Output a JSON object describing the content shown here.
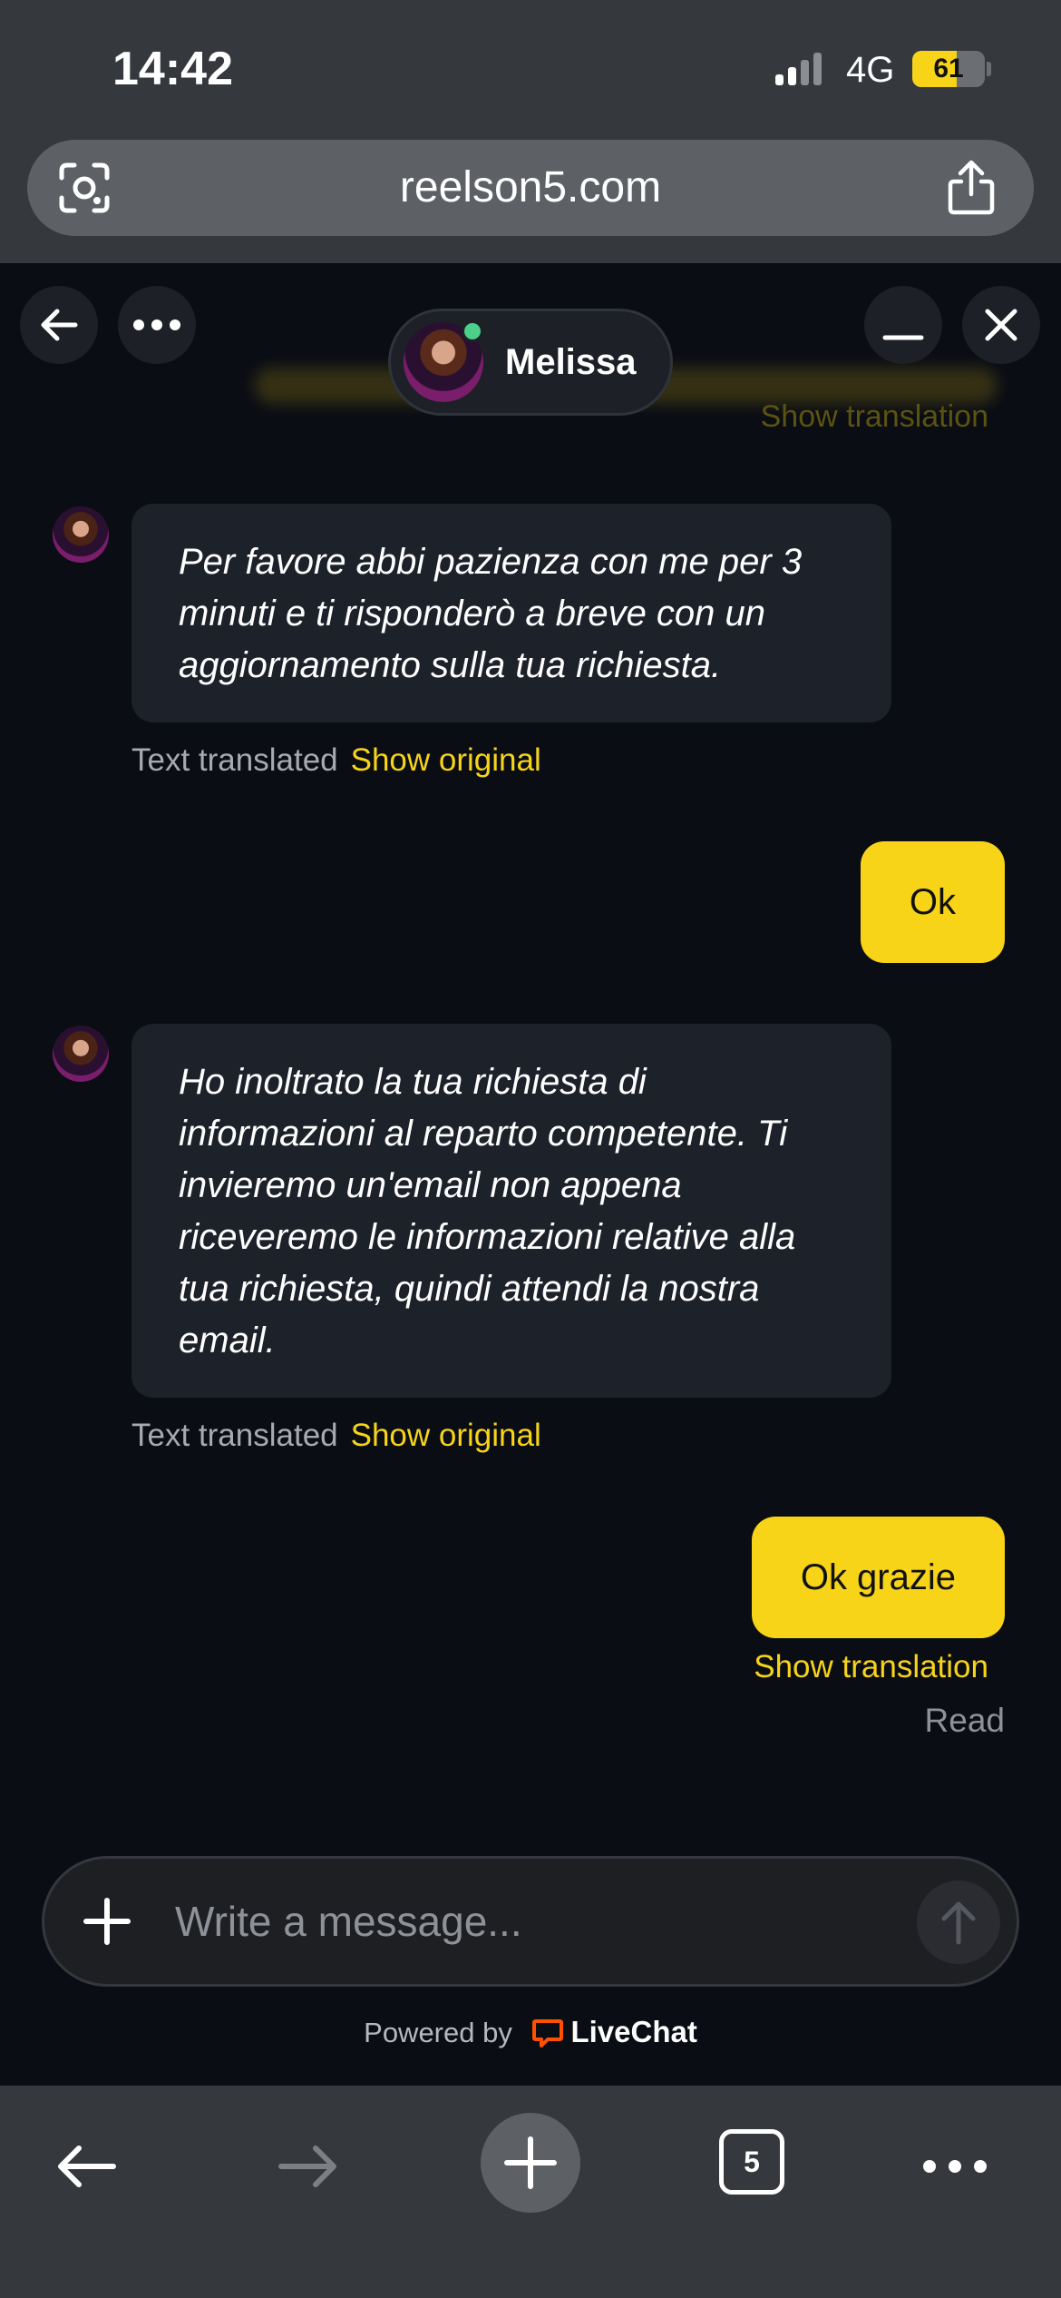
{
  "status_bar": {
    "time": "14:42",
    "network": "4G",
    "battery_level": "61",
    "battery_fraction": 0.61
  },
  "browser": {
    "url": "reelson5.com",
    "open_tabs": "5"
  },
  "chat": {
    "agent_name": "Melissa",
    "agent_status": "online",
    "faded_translation_link": "Show translation",
    "messages": [
      {
        "sender": "agent",
        "text": "Per favore abbi pazienza con me per 3 minuti e ti risponderò a breve con un aggiornamento sulla tua richiesta.",
        "meta_label": "Text translated",
        "meta_link": "Show original"
      },
      {
        "sender": "user",
        "text": "Ok"
      },
      {
        "sender": "agent",
        "text": "Ho inoltrato la tua richiesta di informazioni al reparto competente. Ti invieremo un'email non appena riceveremo le informazioni relative alla tua richiesta, quindi attendi la nostra email.",
        "meta_label": "Text translated",
        "meta_link": "Show original"
      },
      {
        "sender": "user",
        "text": "Ok grazie",
        "translation_link": "Show translation",
        "status": "Read"
      }
    ],
    "composer": {
      "placeholder": "Write a message...",
      "value": ""
    },
    "powered_by_label": "Powered by",
    "powered_by_brand": "LiveChat"
  },
  "colors": {
    "accent": "#f7d418",
    "background": "#0a0d14",
    "agent_bubble": "#1d212a",
    "browser_chrome": "#35383d",
    "online": "#4ccf88",
    "livechat_brand": "#ff5100"
  },
  "icons": {
    "status_bar": [
      "signal-icon",
      "battery-icon"
    ],
    "url_bar": [
      "lens-icon",
      "share-icon"
    ],
    "chat_header": [
      "back-arrow-icon",
      "more-icon",
      "minimize-icon",
      "close-icon"
    ],
    "composer": [
      "plus-icon",
      "send-arrow-icon"
    ],
    "toolbar": [
      "back-icon",
      "forward-icon",
      "new-tab-icon",
      "tabs-icon",
      "more-icon"
    ]
  }
}
